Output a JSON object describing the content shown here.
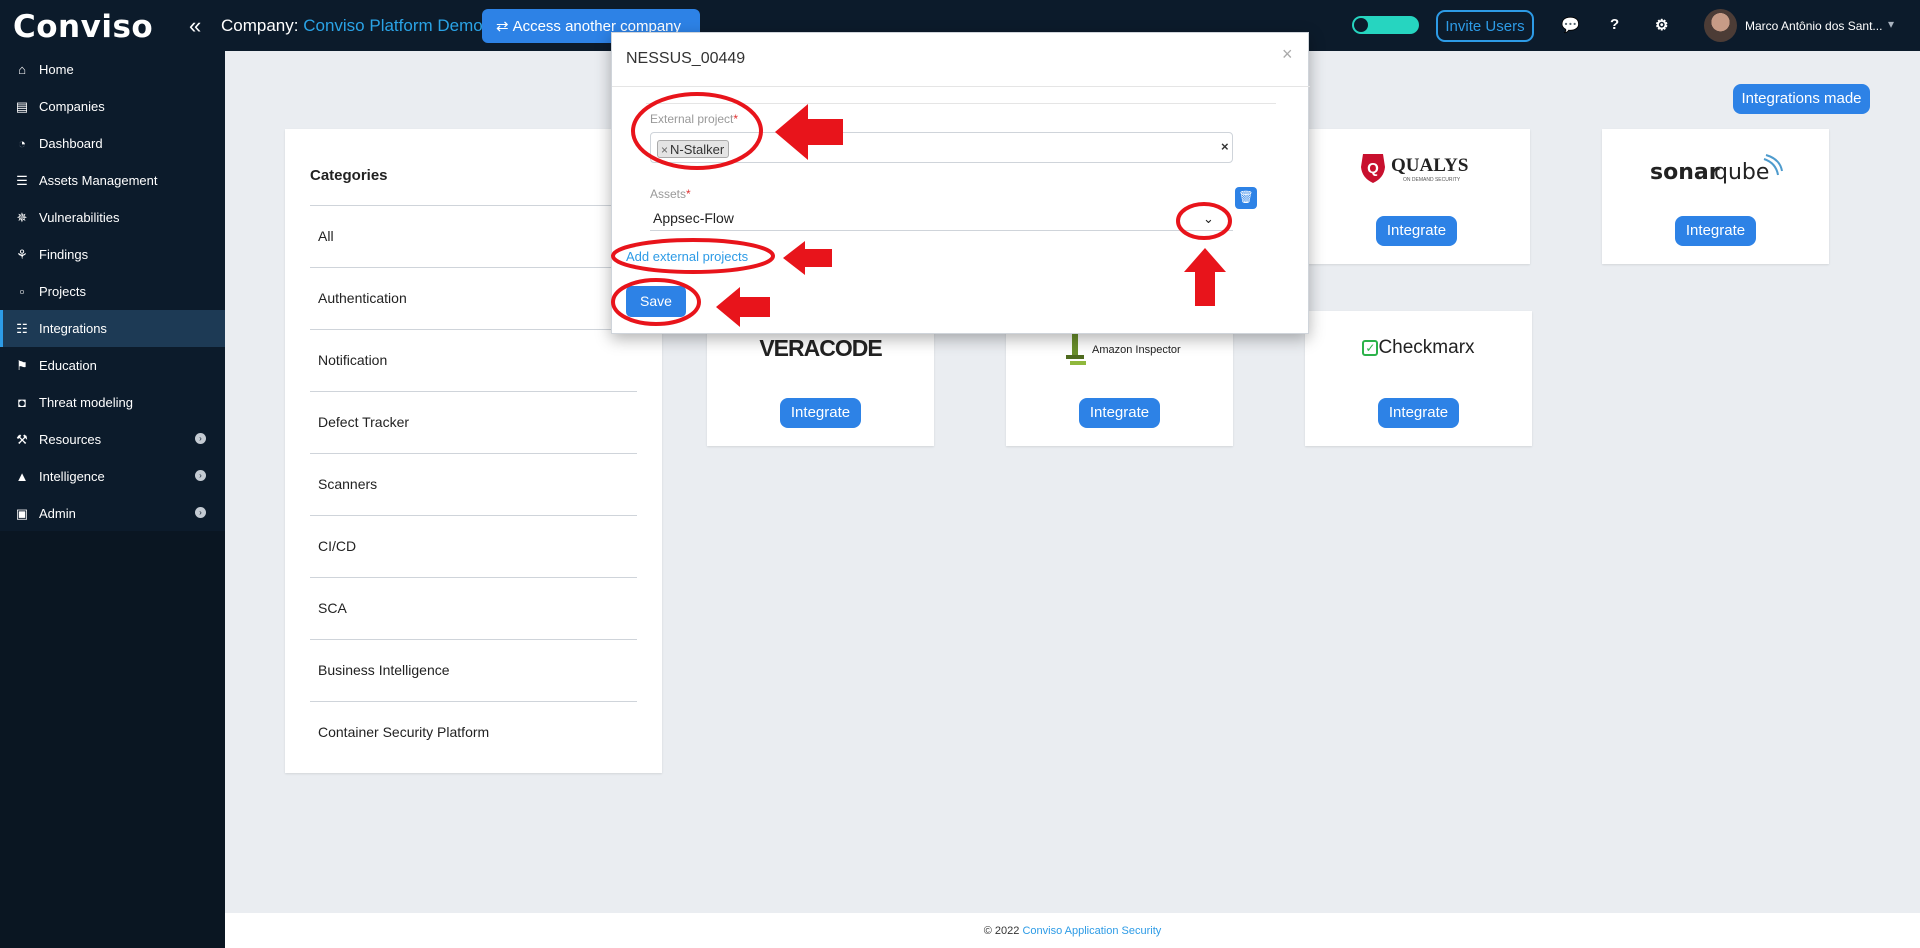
{
  "topbar": {
    "logo": "Conviso",
    "company_label": "Company:",
    "company_name": "Conviso Platform Demo",
    "access_button": "Access another company",
    "invite_button": "Invite Users",
    "chat_icon": "💬",
    "help_icon": "?",
    "settings_icon": "⚙",
    "user_name": "Marco Antônio dos Sant..."
  },
  "sidebar": {
    "items": [
      {
        "label": "Home",
        "icon": "⌂"
      },
      {
        "label": "Companies",
        "icon": "▤"
      },
      {
        "label": "Dashboard",
        "icon": "◔"
      },
      {
        "label": "Assets Management",
        "icon": "☰"
      },
      {
        "label": "Vulnerabilities",
        "icon": "✵"
      },
      {
        "label": "Findings",
        "icon": "⚘"
      },
      {
        "label": "Projects",
        "icon": "▫"
      },
      {
        "label": "Integrations",
        "icon": "☷"
      },
      {
        "label": "Education",
        "icon": "⚑"
      },
      {
        "label": "Threat modeling",
        "icon": "◘"
      },
      {
        "label": "Resources",
        "icon": "⚒"
      },
      {
        "label": "Intelligence",
        "icon": "▲"
      },
      {
        "label": "Admin",
        "icon": "▣"
      }
    ],
    "active": "Integrations"
  },
  "main": {
    "integrations_made": "Integrations made",
    "categories_title": "Categories",
    "categories": [
      "All",
      "Authentication",
      "Notification",
      "Defect Tracker",
      "Scanners",
      "CI/CD",
      "SCA",
      "Business Intelligence",
      "Container Security Platform"
    ],
    "integrate_label": "Integrate",
    "cards": {
      "qualys": "QUALYS",
      "qualys_sub": "ON DEMAND SECURITY",
      "sonarqube_a": "sonar",
      "sonarqube_b": "qube",
      "veracode": "VERACODE",
      "amazon": "Amazon Inspector",
      "checkmarx": "Checkmarx"
    }
  },
  "modal": {
    "title": "NESSUS_00449",
    "external_project_label": "External project",
    "required_mark": "*",
    "selected_tag": "N-Stalker",
    "assets_label": "Assets",
    "assets_value": "Appsec-Flow",
    "add_link": "Add external projects",
    "save": "Save",
    "close": "×"
  },
  "footer": {
    "copyright": "© 2022",
    "link": "Conviso Application Security"
  },
  "colors": {
    "accent": "#2d82e6",
    "sidebar": "#0c1b2b",
    "annotation_red": "#e8141b"
  }
}
